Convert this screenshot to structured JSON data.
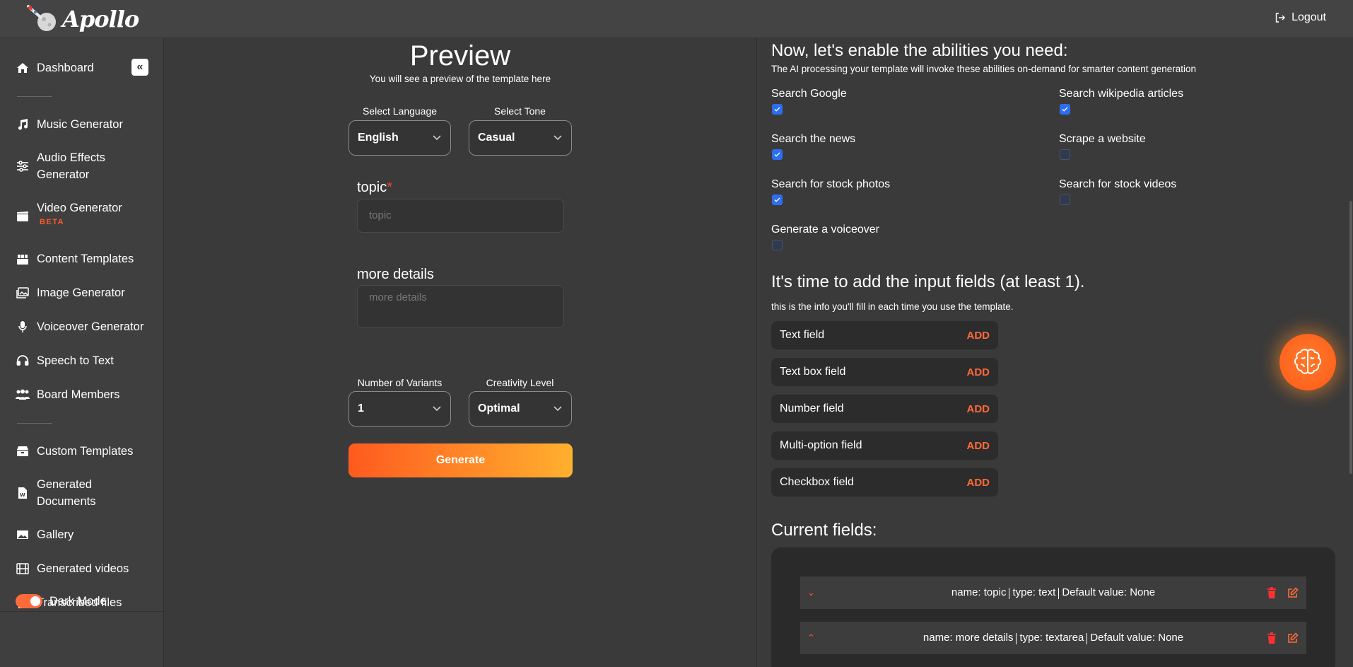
{
  "app": {
    "logo_text": "Apollo",
    "logout_label": "Logout"
  },
  "sidebar": {
    "collapse_symbol": "«",
    "items": [
      {
        "label": "Dashboard",
        "icon": "home-icon"
      },
      {
        "label": "Music Generator",
        "icon": "music-icon"
      },
      {
        "label": "Audio Effects Generator",
        "icon": "sliders-icon"
      },
      {
        "label": "Video Generator",
        "badge": "BETA",
        "icon": "clapperboard-icon"
      },
      {
        "label": "Content Templates",
        "icon": "blocks-icon"
      },
      {
        "label": "Image Generator",
        "icon": "images-icon"
      },
      {
        "label": "Voiceover Generator",
        "icon": "microphone-icon"
      },
      {
        "label": "Speech to Text",
        "icon": "headset-icon"
      },
      {
        "label": "Board Members",
        "icon": "users-icon"
      },
      {
        "label": "Custom Templates",
        "icon": "cabinet-icon"
      },
      {
        "label": "Generated Documents",
        "icon": "word-doc-icon"
      },
      {
        "label": "Gallery",
        "icon": "photo-icon"
      },
      {
        "label": "Generated videos",
        "icon": "film-icon"
      },
      {
        "label": "Transcribed files",
        "icon": "file-icon"
      }
    ],
    "dark_mode_label": "Dark Mode"
  },
  "preview": {
    "title": "Preview",
    "subtitle": "You will see a preview of the template here",
    "language_label": "Select Language",
    "language_value": "English",
    "tone_label": "Select Tone",
    "tone_value": "Casual",
    "topic_label": "topic",
    "topic_required": "*",
    "topic_placeholder": "topic",
    "details_label": "more details",
    "details_placeholder": "more details",
    "variants_label": "Number of Variants",
    "variants_value": "1",
    "creativity_label": "Creativity Level",
    "creativity_value": "Optimal",
    "generate_label": "Generate"
  },
  "abilities": {
    "heading": "Now, let's enable the abilities you need:",
    "description": "The AI processing your template will invoke these abilities on-demand for smarter content generation",
    "items": [
      {
        "label": "Search Google",
        "checked": true
      },
      {
        "label": "Search wikipedia articles",
        "checked": true
      },
      {
        "label": "Search the news",
        "checked": true
      },
      {
        "label": "Scrape a website",
        "checked": false
      },
      {
        "label": "Search for stock photos",
        "checked": true
      },
      {
        "label": "Search for stock videos",
        "checked": false
      },
      {
        "label": "Generate a voiceover",
        "checked": false
      }
    ]
  },
  "input_fields": {
    "heading": "It's time to add the input fields (at least 1).",
    "description": "this is the info you'll fill in each time you use the template.",
    "add_label": "ADD",
    "types": [
      "Text field",
      "Text box field",
      "Number field",
      "Multi-option field",
      "Checkbox field"
    ]
  },
  "current_fields": {
    "heading": "Current fields:",
    "rows": [
      {
        "name": "name: topic",
        "type": "type: text",
        "default": "Default value: None",
        "toggle": "⌄"
      },
      {
        "name": "name: more details",
        "type": "type: textarea",
        "default": "Default value: None",
        "toggle": "⌃"
      }
    ]
  },
  "colors": {
    "accent": "#ff6a3a",
    "checkbox_on": "#2d6ef0",
    "panel_bg": "#3a3a3a"
  }
}
